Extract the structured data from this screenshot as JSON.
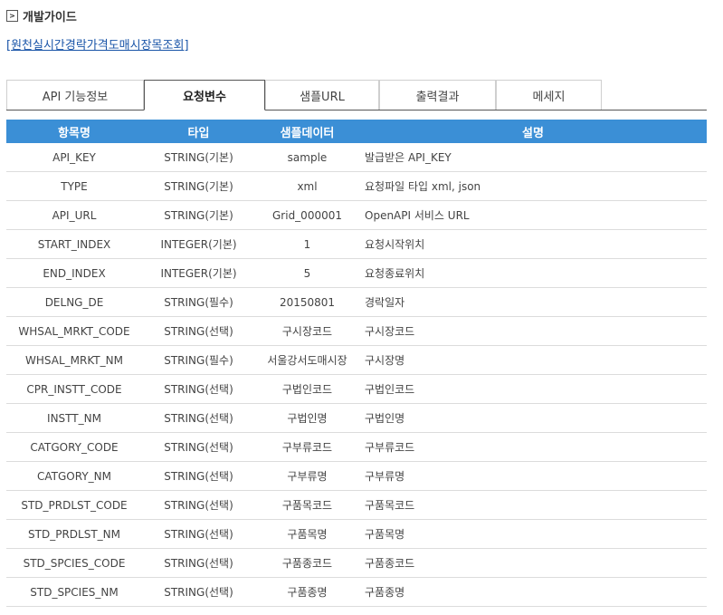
{
  "guide": {
    "title": "개발가이드",
    "icon": "box-arrow-icon"
  },
  "api_link": {
    "open_bracket": "[",
    "text": "원천실시간경락가격도매시장목조회",
    "close_bracket": "]"
  },
  "tabs": [
    {
      "label": "API 기능정보",
      "active": false
    },
    {
      "label": "요청변수",
      "active": true
    },
    {
      "label": "샘플URL",
      "active": false
    },
    {
      "label": "출력결과",
      "active": false
    },
    {
      "label": "메세지",
      "active": false
    }
  ],
  "table": {
    "headers": [
      "항목명",
      "타입",
      "샘플데이터",
      "설명"
    ],
    "rows": [
      [
        "API_KEY",
        "STRING(기본)",
        "sample",
        "발급받은 API_KEY"
      ],
      [
        "TYPE",
        "STRING(기본)",
        "xml",
        "요청파일 타입 xml, json"
      ],
      [
        "API_URL",
        "STRING(기본)",
        "Grid_000001",
        "OpenAPI 서비스 URL"
      ],
      [
        "START_INDEX",
        "INTEGER(기본)",
        "1",
        "요청시작위치"
      ],
      [
        "END_INDEX",
        "INTEGER(기본)",
        "5",
        "요청종료위치"
      ],
      [
        "DELNG_DE",
        "STRING(필수)",
        "20150801",
        "경락일자"
      ],
      [
        "WHSAL_MRKT_CODE",
        "STRING(선택)",
        "구시장코드",
        "구시장코드"
      ],
      [
        "WHSAL_MRKT_NM",
        "STRING(필수)",
        "서울강서도매시장",
        "구시장명"
      ],
      [
        "CPR_INSTT_CODE",
        "STRING(선택)",
        "구법인코드",
        "구법인코드"
      ],
      [
        "INSTT_NM",
        "STRING(선택)",
        "구법인명",
        "구법인명"
      ],
      [
        "CATGORY_CODE",
        "STRING(선택)",
        "구부류코드",
        "구부류코드"
      ],
      [
        "CATGORY_NM",
        "STRING(선택)",
        "구부류명",
        "구부류명"
      ],
      [
        "STD_PRDLST_CODE",
        "STRING(선택)",
        "구품목코드",
        "구품목코드"
      ],
      [
        "STD_PRDLST_NM",
        "STRING(선택)",
        "구품목명",
        "구품목명"
      ],
      [
        "STD_SPCIES_CODE",
        "STRING(선택)",
        "구품종코드",
        "구품종코드"
      ],
      [
        "STD_SPCIES_NM",
        "STRING(선택)",
        "구품종명",
        "구품종명"
      ]
    ]
  },
  "colors": {
    "header_bg": "#3b8fd6",
    "link": "#1a55a8",
    "row_border": "#dcdcdc"
  }
}
